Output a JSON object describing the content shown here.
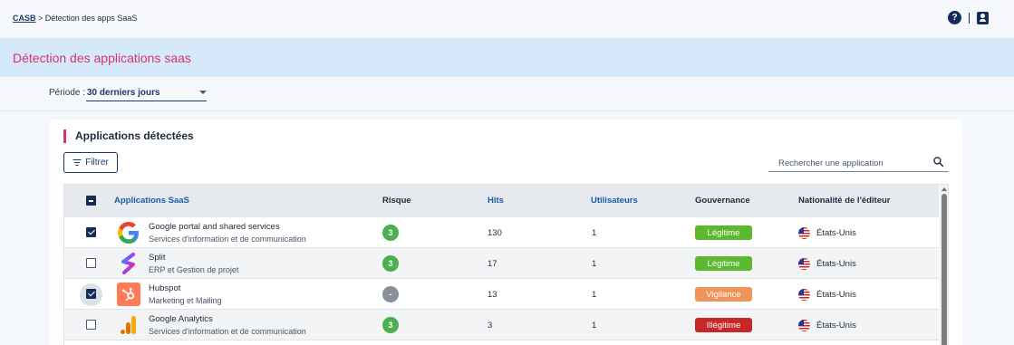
{
  "breadcrumb": {
    "root": "CASB",
    "separator": " > ",
    "current": "Détection des apps SaaS"
  },
  "header": {
    "help_icon": "help-circle-icon",
    "profile_icon": "account-box-icon"
  },
  "banner": {
    "title": "Détection des applications saas"
  },
  "period": {
    "label": "Période :",
    "value": "30 derniers jours"
  },
  "card": {
    "title": "Applications détectées",
    "filter_label": "Filtrer",
    "search_placeholder": "Rechercher une application"
  },
  "table": {
    "columns": [
      "Applications SaaS",
      "Risque",
      "Hits",
      "Utilisateurs",
      "Gouvernance",
      "Nationalité de l'éditeur"
    ],
    "rows": [
      {
        "checked": true,
        "logo": "google-logo-icon",
        "name": "Google portal and shared services",
        "category": "Services d'information et de communication",
        "risk": "3",
        "risk_color": "#4caf50",
        "hits": "130",
        "users": "1",
        "governance": "Légitime",
        "gov_color": "#5cb82e",
        "country": "États-Unis"
      },
      {
        "checked": false,
        "logo": "split-logo-icon",
        "name": "Split",
        "category": "ERP et Gestion de projet",
        "risk": "3",
        "risk_color": "#4caf50",
        "hits": "17",
        "users": "1",
        "governance": "Légitime",
        "gov_color": "#5cb82e",
        "country": "États-Unis"
      },
      {
        "checked": true,
        "logo": "hubspot-logo-icon",
        "name": "Hubspot",
        "category": "Marketing et Mailing",
        "risk": "-",
        "risk_color": "#8a9099",
        "hits": "13",
        "users": "1",
        "governance": "Vigilance",
        "gov_color": "#f0955a",
        "country": "États-Unis"
      },
      {
        "checked": false,
        "logo": "google-analytics-logo-icon",
        "name": "Google Analytics",
        "category": "Services d'information et de communication",
        "risk": "3",
        "risk_color": "#4caf50",
        "hits": "3",
        "users": "1",
        "governance": "Illégitime",
        "gov_color": "#c62828",
        "country": "États-Unis"
      }
    ]
  }
}
